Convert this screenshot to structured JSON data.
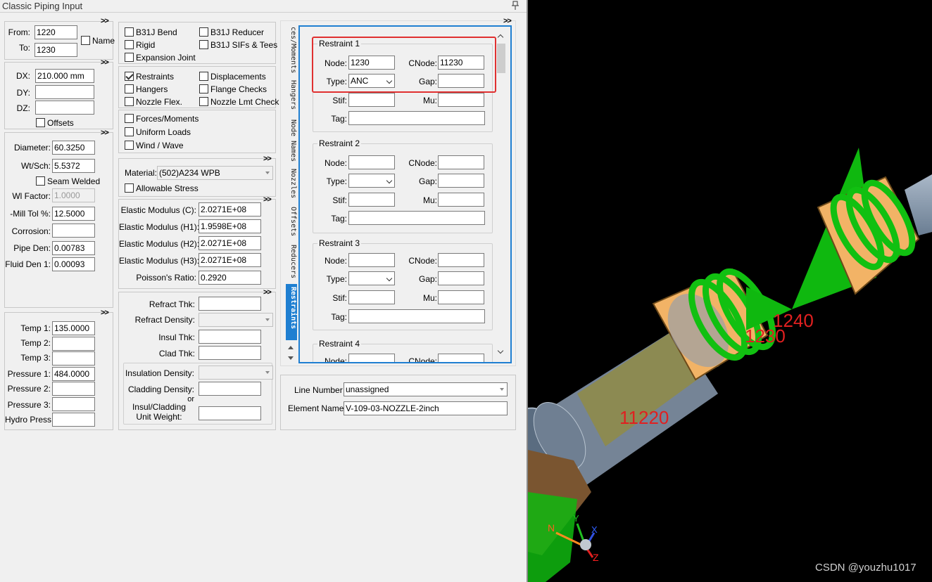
{
  "window": {
    "title": "Classic Piping Input",
    "pin_icon": "pin-icon",
    "expand_glyph": ">>"
  },
  "nodes": {
    "from_label": "From:",
    "from_value": "1220",
    "to_label": "To:",
    "to_value": "1230",
    "name_label": "Name"
  },
  "deltas": {
    "dx_label": "DX:",
    "dx_value": "210.000 mm",
    "dy_label": "DY:",
    "dy_value": "",
    "dz_label": "DZ:",
    "dz_value": "",
    "offsets_label": "Offsets"
  },
  "pipe": {
    "diameter_label": "Diameter:",
    "diameter_value": "60.3250",
    "wtsch_label": "Wt/Sch:",
    "wtsch_value": "5.5372",
    "seam_label": "Seam Welded",
    "wlfactor_label": "Wl Factor:",
    "wlfactor_value": "1.0000",
    "milltol_label": "-Mill Tol %:",
    "milltol_value": "12.5000",
    "corrosion_label": "Corrosion:",
    "corrosion_value": "",
    "pipeden_label": "Pipe Den:",
    "pipeden_value": "0.00783",
    "fluidden_label": "Fluid Den 1:",
    "fluidden_value": "0.00093"
  },
  "loads": {
    "temp1_label": "Temp 1:",
    "temp1_value": "135.0000",
    "temp2_label": "Temp 2:",
    "temp2_value": "",
    "temp3_label": "Temp 3:",
    "temp3_value": "",
    "press1_label": "Pressure 1:",
    "press1_value": "484.0000",
    "press2_label": "Pressure 2:",
    "press2_value": "",
    "press3_label": "Pressure 3:",
    "press3_value": "",
    "hydro_label": "Hydro Press:",
    "hydro_value": ""
  },
  "elements": {
    "b31j_bend": "B31J Bend",
    "b31j_reducer": "B31J Reducer",
    "rigid": "Rigid",
    "b31j_sifs": "B31J SIFs & Tees",
    "expansion_joint": "Expansion Joint",
    "restraints": "Restraints",
    "displacements": "Displacements",
    "hangers": "Hangers",
    "flange_checks": "Flange Checks",
    "nozzle_flex": "Nozzle Flex.",
    "nozzle_lmt": "Nozzle Lmt Check",
    "forces_moments": "Forces/Moments",
    "uniform_loads": "Uniform Loads",
    "wind_wave": "Wind / Wave"
  },
  "material": {
    "label": "Material:",
    "value": "(502)A234 WPB",
    "allowable_label": "Allowable Stress"
  },
  "elastic": {
    "c_label": "Elastic Modulus (C):",
    "c_value": "2.0271E+08",
    "h1_label": "Elastic Modulus (H1):",
    "h1_value": "1.9598E+08",
    "h2_label": "Elastic Modulus (H2):",
    "h2_value": "2.0271E+08",
    "h3_label": "Elastic Modulus (H3):",
    "h3_value": "2.0271E+08",
    "poisson_label": "Poisson's Ratio:",
    "poisson_value": "0.2920"
  },
  "insulation": {
    "refract_thk_label": "Refract Thk:",
    "refract_den_label": "Refract Density:",
    "insul_thk_label": "Insul Thk:",
    "clad_thk_label": "Clad Thk:",
    "insul_den_label": "Insulation Density:",
    "clad_den_label": "Cladding Density:",
    "or_label": "or",
    "unit_weight_label": "Insul/Cladding\nUnit Weight:"
  },
  "tabs": [
    "ces/Moments",
    "Hangers",
    "Node Names",
    "Nozzles",
    "Offsets",
    "Reducers",
    "Restraints"
  ],
  "active_tab": "Restraints",
  "restraint_labels": {
    "node": "Node:",
    "cnode": "CNode:",
    "type": "Type:",
    "gap": "Gap:",
    "stif": "Stif:",
    "mu": "Mu:",
    "tag": "Tag:"
  },
  "restraints": [
    {
      "title": "Restraint 1",
      "node": "1230",
      "cnode": "11230",
      "type": "ANC",
      "gap": "",
      "stif": "",
      "mu": "",
      "tag": ""
    },
    {
      "title": "Restraint 2",
      "node": "",
      "cnode": "",
      "type": "",
      "gap": "",
      "stif": "",
      "mu": "",
      "tag": ""
    },
    {
      "title": "Restraint 3",
      "node": "",
      "cnode": "",
      "type": "",
      "gap": "",
      "stif": "",
      "mu": "",
      "tag": ""
    },
    {
      "title": "Restraint 4",
      "node": "",
      "cnode": "",
      "type": "",
      "gap": "",
      "stif": "",
      "mu": "",
      "tag": ""
    }
  ],
  "line": {
    "line_number_label": "Line Number :",
    "line_number_value": "unassigned",
    "element_name_label": "Element Name :",
    "element_name_value": "V-109-03-NOZZLE-2inch"
  },
  "viewport": {
    "node_labels": [
      "1240",
      "1230",
      "11220"
    ],
    "axes": {
      "x": "X",
      "y": "Y",
      "z": "Z",
      "n": "N"
    },
    "watermark": "CSDN @youzhu1017",
    "colors": {
      "background": "#000000",
      "node_label": "#e02020",
      "restraint_green": "#00c000",
      "restraint_box": "#f0b060",
      "pipe": "#8fa3b8",
      "highlight": "#e03030"
    }
  }
}
